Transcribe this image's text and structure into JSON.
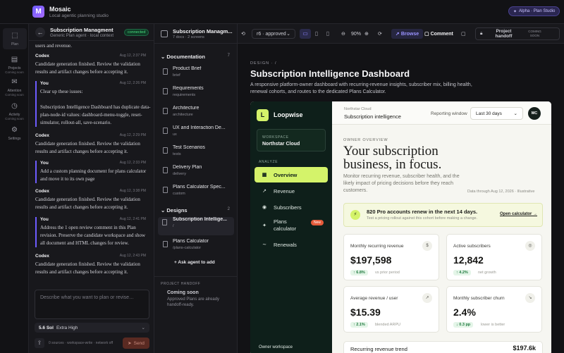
{
  "app": {
    "name": "Mosaic",
    "subtitle": "Local agentic planning studio",
    "badge": "Alpha · Plan Studio"
  },
  "rail": [
    {
      "label": "Plan",
      "note": "",
      "icon": "plan-icon"
    },
    {
      "label": "Projects",
      "note": "Coming soon",
      "icon": "projects-icon"
    },
    {
      "label": "Attention",
      "note": "Coming soon",
      "icon": "attention-icon"
    },
    {
      "label": "Activity",
      "note": "Coming soon",
      "icon": "activity-icon"
    },
    {
      "label": "Settings",
      "note": "",
      "icon": "settings-icon"
    }
  ],
  "chat": {
    "title": "Subscription Managment",
    "subtitle": "Generic Plan agent · local context",
    "status": "connected",
    "top_fragment": "users and revenue.",
    "messages": [
      {
        "who": "Codex",
        "time": "Aug 12, 2:37 PM",
        "text": "Candidate generation finished. Review the validation results and artifact changes before accepting it."
      },
      {
        "who": "You",
        "time": "Aug 12, 2:26 PM",
        "text": "Clear up these issues:\n\nSubscription Intelligence Dashboard has duplicate data-plan-node-id values: dashboard-menu-toggle, reset-simulator, rollout-all, save-scenario."
      },
      {
        "who": "Codex",
        "time": "Aug 12, 2:29 PM",
        "text": "Candidate generation finished. Review the validation results and artifact changes before accepting it."
      },
      {
        "who": "You",
        "time": "Aug 12, 2:33 PM",
        "text": "Add a custom planning document for plans calculator and move it to its own page"
      },
      {
        "who": "Codex",
        "time": "Aug 12, 3:38 PM",
        "text": "Candidate generation finished. Review the validation results and artifact changes before accepting it."
      },
      {
        "who": "You",
        "time": "Aug 12, 2:41 PM",
        "text": "Address the 1 open review comment in this Plan revision. Preserve the candidate workspace and show all document and HTML changes for review."
      },
      {
        "who": "Codex",
        "time": "Aug 12, 2:43 PM",
        "text": "Candidate generation finished. Review the validation results and artifact changes before accepting it."
      }
    ],
    "composer_placeholder": "Describe what you want to plan or revise…",
    "model": "5.6 Sol",
    "effort": "Extra High",
    "meta": "0 sources · workspace-write · network off",
    "send_label": "Send"
  },
  "docs": {
    "title": "Subscription Managm...",
    "subtitle": "7 docs · 2 screens",
    "documentation_label": "Documentation",
    "documentation_count": "7",
    "items": [
      {
        "name": "Product Brief",
        "type": "brief"
      },
      {
        "name": "Requirements",
        "type": "requirements"
      },
      {
        "name": "Architecture",
        "type": "architecture"
      },
      {
        "name": "UX and Interaction De...",
        "type": "ux"
      },
      {
        "name": "Test Scenarios",
        "type": "tests"
      },
      {
        "name": "Delivery Plan",
        "type": "delivery"
      },
      {
        "name": "Plans Calculator Spec...",
        "type": "custom"
      }
    ],
    "designs_label": "Designs",
    "designs_count": "2",
    "designs": [
      {
        "name": "Subscription Intellige...",
        "path": "/"
      },
      {
        "name": "Plans Calculator",
        "path": "/plans-calculator"
      }
    ],
    "ask_agent": "Ask agent to add",
    "handoff_label": "PROJECT HANDOFF",
    "handoff_title": "Coming soon",
    "handoff_desc": "Approved Plans are already handoff-ready."
  },
  "toolbar": {
    "revision": "r6 · approved",
    "zoom": "90%",
    "browse": "Browse",
    "comment": "Comment",
    "handoff": "Project handoff",
    "handoff_note": "COMING SOON"
  },
  "canvas": {
    "crumb": "DESIGN · /",
    "title": "Subscription Intelligence Dashboard",
    "description": "A responsive platform-owner dashboard with recurring-revenue insights, subscriber mix, billing health, renewal cohorts, and routes to the dedicated Plans Calculator."
  },
  "app_preview": {
    "brand": "Loopwise",
    "brand_initial": "L",
    "workspace_label": "WORKSPACE",
    "workspace_name": "Northstar Cloud",
    "analyze_label": "ANALYZE",
    "nav": [
      {
        "label": "Overview",
        "icon": "grid-icon",
        "glyph": "▦"
      },
      {
        "label": "Revenue",
        "icon": "trend-icon",
        "glyph": "↗"
      },
      {
        "label": "Subscribers",
        "icon": "users-icon",
        "glyph": "◉"
      },
      {
        "label": "Plans calculator",
        "icon": "calculator-icon",
        "glyph": "✦",
        "badge": "New"
      },
      {
        "label": "Renewals",
        "icon": "renewals-icon",
        "glyph": "∼"
      }
    ],
    "owner_workspace": "Owner workspace",
    "header_sup": "Northstar Cloud",
    "header_title": "Subscription intelligence",
    "reporting_label": "Reporting window",
    "reporting_value": "Last 30 days",
    "avatar": "MC",
    "overview_label": "OWNER OVERVIEW",
    "hero": "Your subscription business, in focus.",
    "hero_sub": "Monitor recurring revenue, subscriber health, and the likely impact of pricing decisions before they reach customers.",
    "hero_meta": "Data through Aug 12, 2026 · Illustrative",
    "banner_title": "820 Pro accounts renew in the next 14 days.",
    "banner_desc": "Test a pricing rollout against this cohort before making a change.",
    "banner_link": "Open calculator →",
    "kpis": [
      {
        "label": "Monthly recurring revenue",
        "value": "$197,598",
        "change": "↑ 6.8%",
        "note": "vs prior period",
        "icon": "dollar-icon",
        "glyph": "$"
      },
      {
        "label": "Active subscribers",
        "value": "12,842",
        "change": "↑ 4.2%",
        "note": "net growth",
        "icon": "subscribers-icon",
        "glyph": "◎"
      },
      {
        "label": "Average revenue / user",
        "value": "$15.39",
        "change": "↑ 2.1%",
        "note": "blended ARPU",
        "icon": "arrow-icon",
        "glyph": "↗"
      },
      {
        "label": "Monthly subscriber churn",
        "value": "2.4%",
        "change": "↓ 0.3 pp",
        "note": "lower is better",
        "icon": "churn-icon",
        "glyph": "↘"
      }
    ],
    "trend_label": "Recurring revenue trend",
    "trend_value": "$197.6k"
  }
}
